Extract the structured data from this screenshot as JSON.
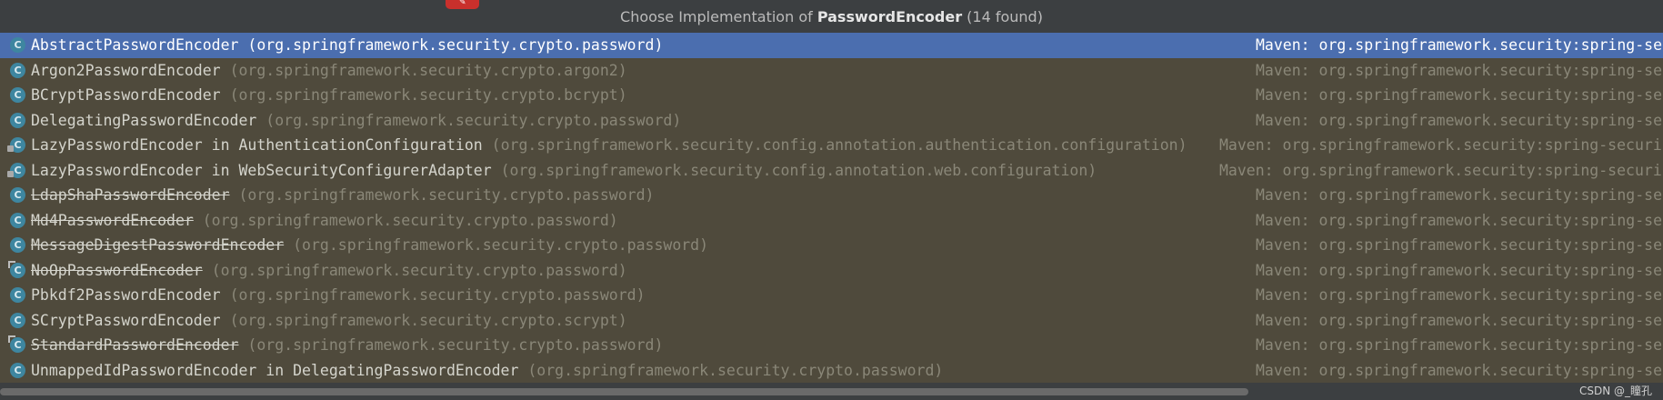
{
  "header": {
    "prefix": "Choose Implementation of ",
    "interface": "PasswordEncoder",
    "suffix": " (14 found)"
  },
  "items": [
    {
      "name": "AbstractPasswordEncoder",
      "package": "(org.springframework.security.crypto.password)",
      "library": "Maven: org.springframework.security:spring-se",
      "icon": "abstract-class-icon",
      "selected": true
    },
    {
      "name": "Argon2PasswordEncoder",
      "package": "(org.springframework.security.crypto.argon2)",
      "library": "Maven: org.springframework.security:spring-se",
      "icon": "class-icon"
    },
    {
      "name": "BCryptPasswordEncoder",
      "package": "(org.springframework.security.crypto.bcrypt)",
      "library": "Maven: org.springframework.security:spring-se",
      "icon": "class-icon"
    },
    {
      "name": "DelegatingPasswordEncoder",
      "package": "(org.springframework.security.crypto.password)",
      "library": "Maven: org.springframework.security:spring-se",
      "icon": "class-icon"
    },
    {
      "name": "LazyPasswordEncoder in AuthenticationConfiguration",
      "package": "(org.springframework.security.config.annotation.authentication.configuration)",
      "library": "Maven: org.springframework.security:spring-securi",
      "icon": "private-class-icon"
    },
    {
      "name": "LazyPasswordEncoder in WebSecurityConfigurerAdapter",
      "package": "(org.springframework.security.config.annotation.web.configuration)",
      "library": "Maven: org.springframework.security:spring-securi",
      "icon": "private-class-icon"
    },
    {
      "name": "LdapShaPasswordEncoder",
      "package": "(org.springframework.security.crypto.password)",
      "library": "Maven: org.springframework.security:spring-se",
      "icon": "class-icon",
      "deprecated": true
    },
    {
      "name": "Md4PasswordEncoder",
      "package": "(org.springframework.security.crypto.password)",
      "library": "Maven: org.springframework.security:spring-se",
      "icon": "class-icon",
      "deprecated": true
    },
    {
      "name": "MessageDigestPasswordEncoder",
      "package": "(org.springframework.security.crypto.password)",
      "library": "Maven: org.springframework.security:spring-se",
      "icon": "class-icon",
      "deprecated": true
    },
    {
      "name": "NoOpPasswordEncoder",
      "package": "(org.springframework.security.crypto.password)",
      "library": "Maven: org.springframework.security:spring-se",
      "icon": "final-class-icon",
      "deprecated": true
    },
    {
      "name": "Pbkdf2PasswordEncoder",
      "package": "(org.springframework.security.crypto.password)",
      "library": "Maven: org.springframework.security:spring-se",
      "icon": "class-icon"
    },
    {
      "name": "SCryptPasswordEncoder",
      "package": "(org.springframework.security.crypto.scrypt)",
      "library": "Maven: org.springframework.security:spring-se",
      "icon": "class-icon"
    },
    {
      "name": "StandardPasswordEncoder",
      "package": "(org.springframework.security.crypto.password)",
      "library": "Maven: org.springframework.security:spring-se",
      "icon": "final-class-icon",
      "deprecated": true
    },
    {
      "name": "UnmappedIdPasswordEncoder in DelegatingPasswordEncoder",
      "package": "(org.springframework.security.crypto.password)",
      "library": "Maven: org.springframework.security:spring-se",
      "icon": "class-icon"
    }
  ],
  "watermark": "CSDN @_瞳孔",
  "colors": {
    "selection": "#4b6eaf",
    "background": "#4f4a3c",
    "header": "#3c3f41",
    "class_icon": "#3e86a0"
  }
}
